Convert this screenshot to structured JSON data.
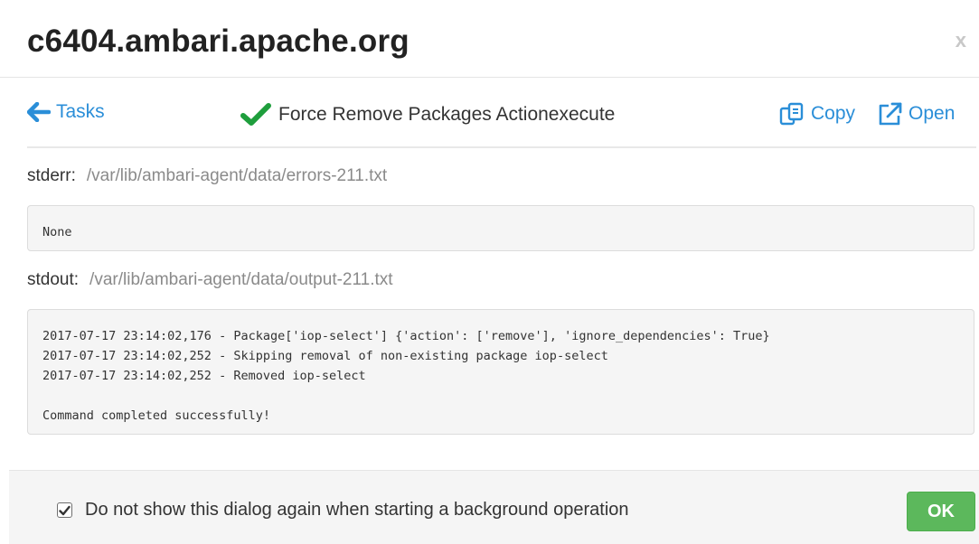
{
  "dialog": {
    "title": "c6404.ambari.apache.org",
    "close_label": "x"
  },
  "toolbar": {
    "back_label": "Tasks",
    "back_icon": "arrow-left-icon",
    "task_title": "Force Remove Packages Actionexecute",
    "task_status_icon": "checkmark-icon",
    "copy_label": "Copy",
    "copy_icon": "copy-icon",
    "open_label": "Open",
    "open_icon": "external-link-icon"
  },
  "stderr": {
    "label": "stderr:",
    "path": "/var/lib/ambari-agent/data/errors-211.txt",
    "lines": [
      "None"
    ]
  },
  "stdout": {
    "label": "stdout:",
    "path": "/var/lib/ambari-agent/data/output-211.txt",
    "lines": [
      "2017-07-17 23:14:02,176 - Package['iop-select'] {'action': ['remove'], 'ignore_dependencies': True}",
      "2017-07-17 23:14:02,252 - Skipping removal of non-existing package iop-select",
      "2017-07-17 23:14:02,252 - Removed iop-select",
      "",
      "Command completed successfully!"
    ]
  },
  "footer": {
    "checkbox_label": "Do not show this dialog again when starting a background operation",
    "checkbox_checked": true,
    "ok_label": "OK"
  },
  "colors": {
    "link": "#2a8ed8",
    "success_check": "#1e9e3c",
    "ok_button": "#5cb85c"
  }
}
